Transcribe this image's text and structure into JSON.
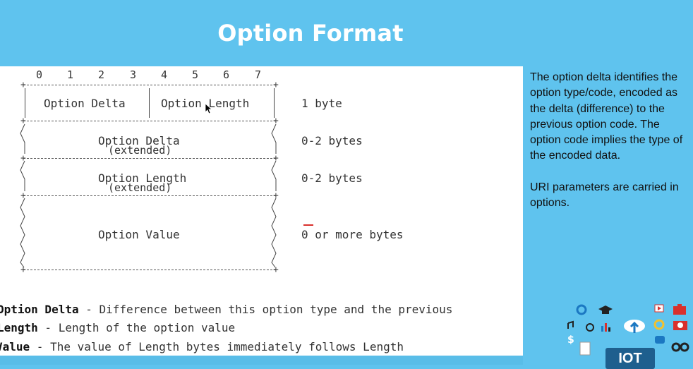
{
  "slide": {
    "title": "Option Format"
  },
  "diagram": {
    "bits": [
      "0",
      "1",
      "2",
      "3",
      "4",
      "5",
      "6",
      "7"
    ],
    "rows": [
      {
        "left": "Option Delta",
        "right": "Option Length",
        "size": "1 byte"
      },
      {
        "main": "Option Delta",
        "sub": "(extended)",
        "size": "0-2 bytes"
      },
      {
        "main": "Option Length",
        "sub": "(extended)",
        "size": "0-2 bytes"
      },
      {
        "main": "Option Value",
        "size": "0 or more bytes"
      }
    ]
  },
  "definitions": [
    {
      "term": "Option Delta",
      "text": " - Difference between this option type and the previous"
    },
    {
      "term": "Length",
      "text": " - Length of the option value"
    },
    {
      "term": "Value",
      "text": " - The value of Length bytes immediately follows Length"
    }
  ],
  "sidebar": {
    "paragraph1": "The option delta identifies the option type/code, encoded as the delta (difference) to the previous option code. The option code implies the type of the encoded data.",
    "paragraph2": "URI parameters are carried in options."
  },
  "badge": {
    "label": "IOT"
  },
  "icons": [
    "gear-icon",
    "graduation-cap-icon",
    "cloud-upload-icon",
    "play-icon",
    "briefcase-icon",
    "music-icon",
    "circle-icon",
    "bar-chart-icon",
    "refresh-icon",
    "camera-icon",
    "dollar-icon",
    "document-icon",
    "chat-icon",
    "glasses-icon"
  ],
  "colors": {
    "background": "#5fc3ee",
    "panel": "#ffffff",
    "badge": "#1e5f8e",
    "accent_red": "#d9302c"
  }
}
